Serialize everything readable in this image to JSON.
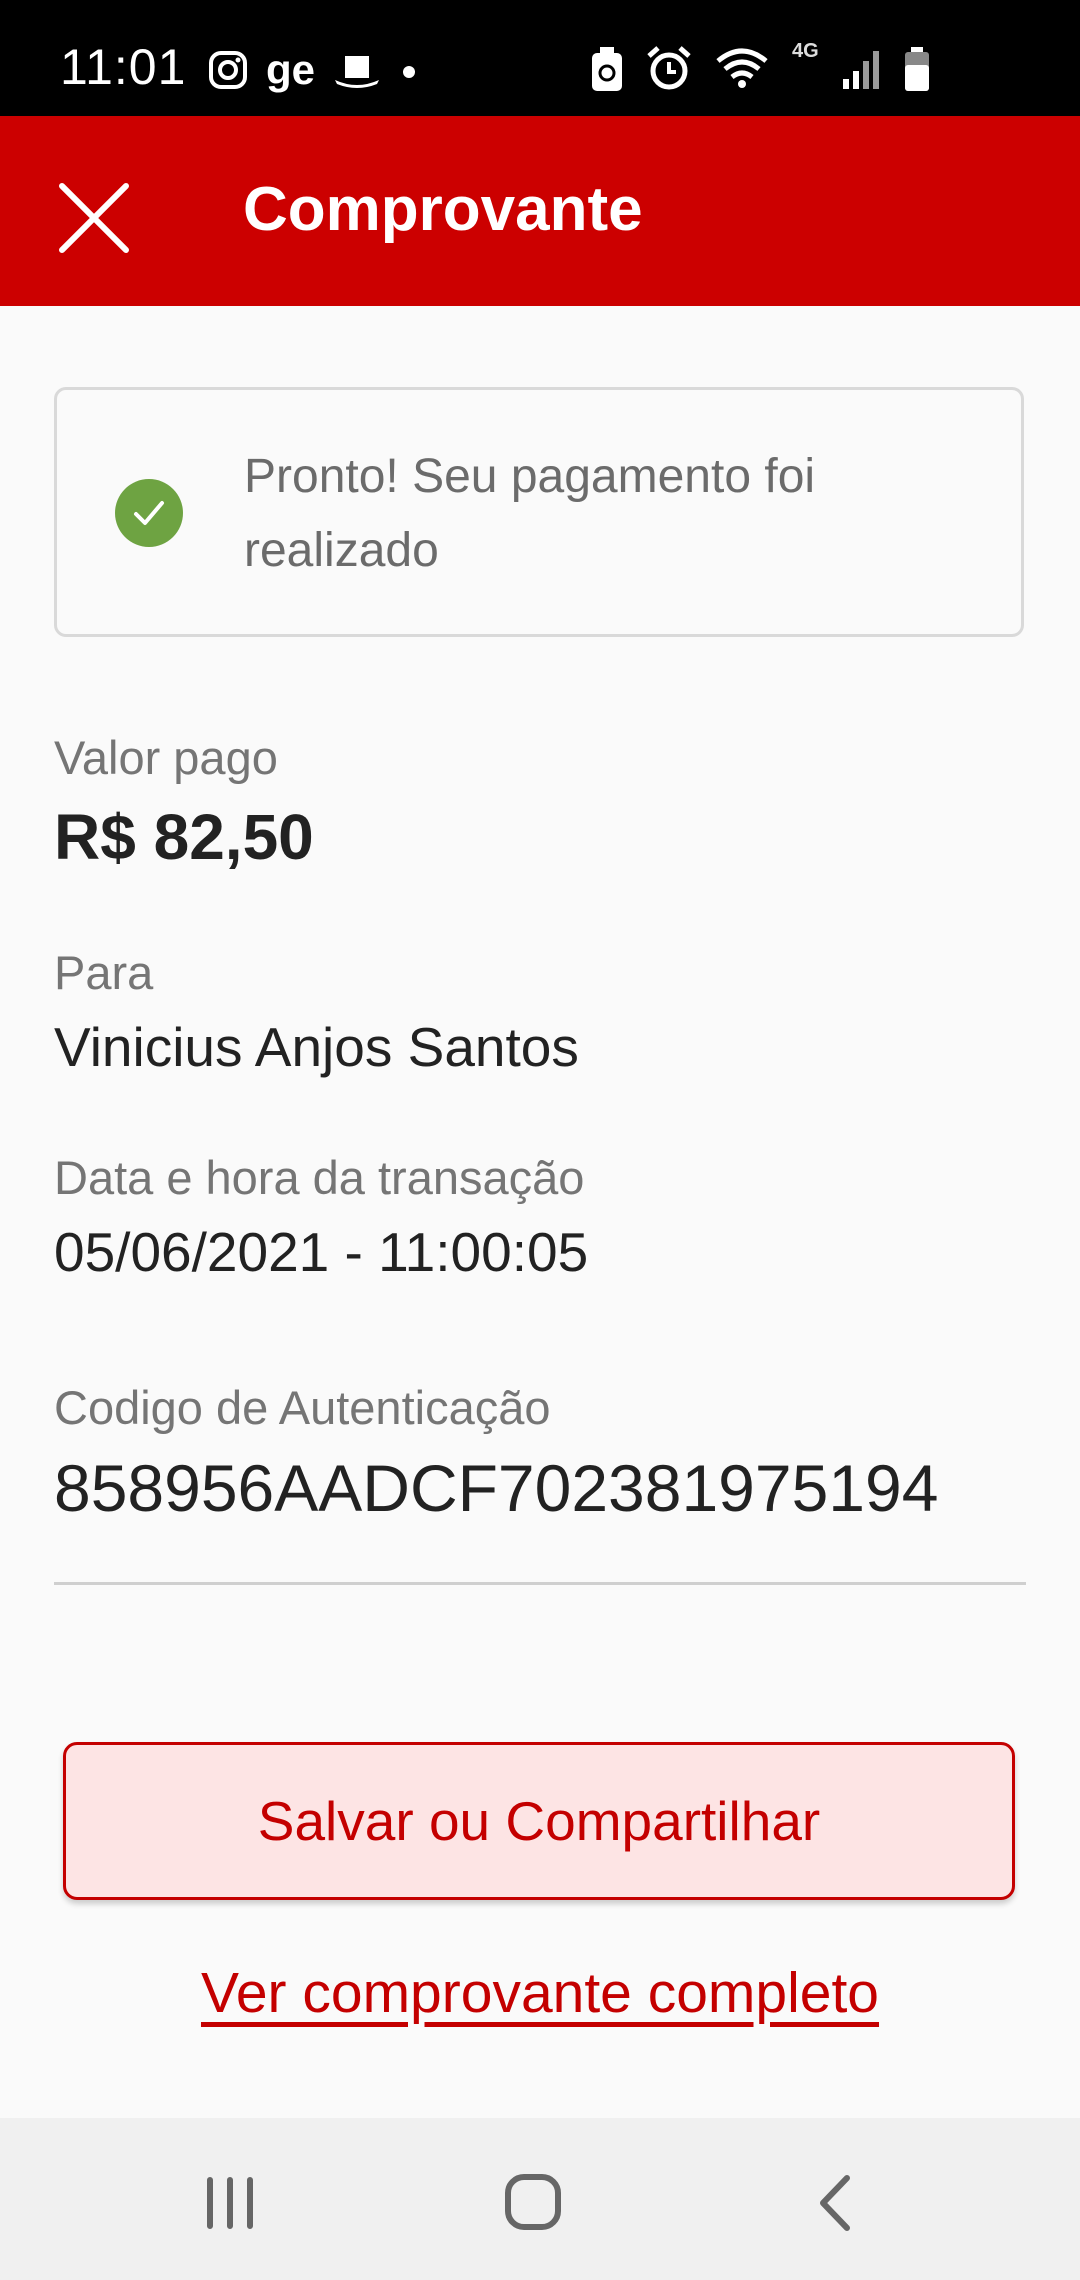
{
  "status_bar": {
    "time": "11:01",
    "app_label": "ge",
    "network_label": "4G",
    "icons": [
      "instagram-icon",
      "hat-icon",
      "dot-icon",
      "battery-saver-icon",
      "alarm-icon",
      "wifi-icon",
      "signal-icon",
      "battery-icon"
    ]
  },
  "header": {
    "title": "Comprovante",
    "close_icon": "close-icon"
  },
  "success": {
    "message": "Pronto! Seu pagamento foi realizado",
    "icon": "check-circle-icon",
    "color": "#6ea342"
  },
  "details": {
    "amount_label": "Valor pago",
    "amount_value": "R$ 82,50",
    "recipient_label": "Para",
    "recipient_value": "Vinicius Anjos Santos",
    "datetime_label": "Data e hora da transação",
    "datetime_value": "05/06/2021 - 11:00:05",
    "auth_label": "Codigo de Autenticação",
    "auth_value": "858956AADCF702381975194"
  },
  "actions": {
    "save_share_label": "Salvar ou Compartilhar",
    "full_receipt_label": "Ver comprovante completo"
  },
  "nav": {
    "recents_icon": "recents-icon",
    "home_icon": "home-icon",
    "back_icon": "back-icon"
  },
  "colors": {
    "brand_red": "#cc0000",
    "button_bg": "#fde4e4",
    "success_green": "#6ea342"
  }
}
